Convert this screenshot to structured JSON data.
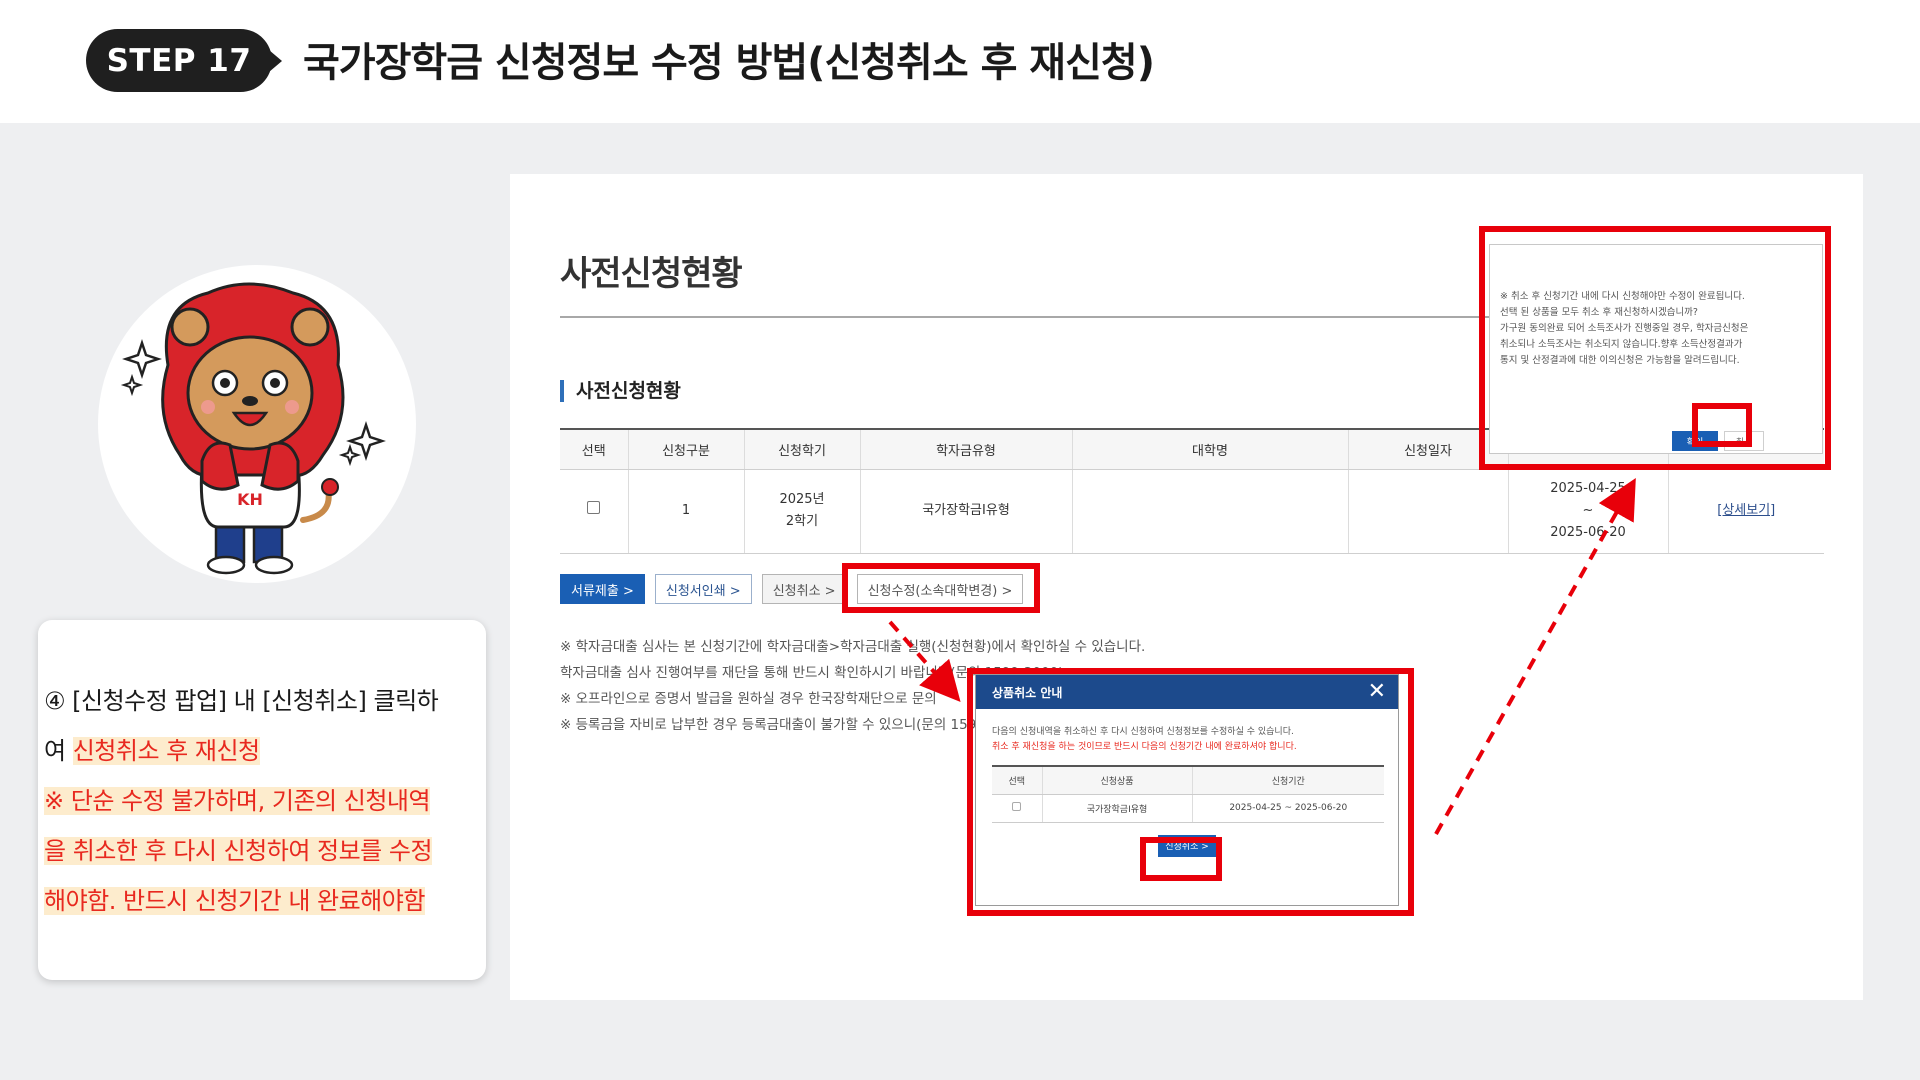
{
  "header": {
    "step_label": "STEP 17",
    "title": "국가장학금 신청정보 수정 방법(신청취소 후 재신청)"
  },
  "instruction": {
    "line1": "④ [신청수정 팝업] 내 [신청취소] 클릭하",
    "line2_prefix": "여 ",
    "line2_highlight": "신청취소 후 재신청",
    "warn_lines": [
      "※ 단순 수정 불가하며, 기존의 신청내역",
      "을 취소한 후 다시 신청하여 정보를 수정",
      "해야함. 반드시 신청기간 내 완료해야함"
    ]
  },
  "screen": {
    "page_title": "사전신청현황",
    "section_title": "사전신청현황",
    "table": {
      "headers": [
        "선택",
        "신청구분",
        "신청학기",
        "학자금유형",
        "대학명",
        "신청일자",
        "",
        ""
      ],
      "row": {
        "index": "1",
        "term_line1": "2025년",
        "term_line2": "2학기",
        "type": "국가장학금I유형",
        "university": "",
        "date": "",
        "period_start": "2025-04-25",
        "period_sep": "~",
        "period_end": "2025-06-20",
        "detail_link": "[상세보기]"
      }
    },
    "buttons": {
      "submit_docs": "서류제출 >",
      "print_form": "신청서인쇄 >",
      "cancel": "신청취소 >",
      "modify": "신청수정(소속대학변경) >"
    },
    "notes": [
      "※ 학자금대출 심사는 본 신청기간에 학자금대출>학자금대출 실행(신청현황)에서 확인하실 수 있습니다.",
      "    학자금대출 심사 진행여부를 재단을 통해 반드시 확인하시기 바랍니다(문의 1599-2000)",
      "※ 오프라인으로 증명서 발급을 원하실 경우 한국장학재단으로 문의",
      "※ 등록금을 자비로 납부한 경우 등록금대출이 불가할 수 있으니(문의 1599-2000)"
    ]
  },
  "cancel_popup": {
    "title": "상품취소 안내",
    "close_glyph": "✕",
    "text1": "다음의 신청내역을 취소하신 후 다시 신청하여 신청정보를 수정하실 수 있습니다.",
    "text2": "취소 후 재신청을 하는 것이므로 반드시 다음의 신청기간 내에 완료하셔야 합니다.",
    "headers": [
      "선택",
      "신청상품",
      "신청기간"
    ],
    "row": {
      "product": "국가장학금I유형",
      "period": "2025-04-25 ~ 2025-06-20"
    },
    "button": "신청취소 >"
  },
  "confirm_popup": {
    "lines": [
      "※ 취소 후 신청기간 내에 다시 신청해야만 수정이 완료됩니다.",
      "    선택 된 상품을 모두 취소 후 재신청하시겠습니까?",
      "가구원 동의완료 되어 소득조사가 진행중일 경우, 학자금신청은",
      "취소되나 소득조사는 취소되지 않습니다.향후 소득산정결과가",
      "통지 및 산정결과에 대한 이의신청은 가능함을 알려드립니다."
    ],
    "ok": "확인",
    "cancel": "취소"
  },
  "colors": {
    "highlight_red": "#e8000a",
    "primary_blue": "#1a5fb4",
    "header_navy": "#1c4a8c"
  },
  "icons": {
    "mascot": "lion-mascot-illustration",
    "close": "close-icon",
    "checkbox": "checkbox-icon"
  }
}
